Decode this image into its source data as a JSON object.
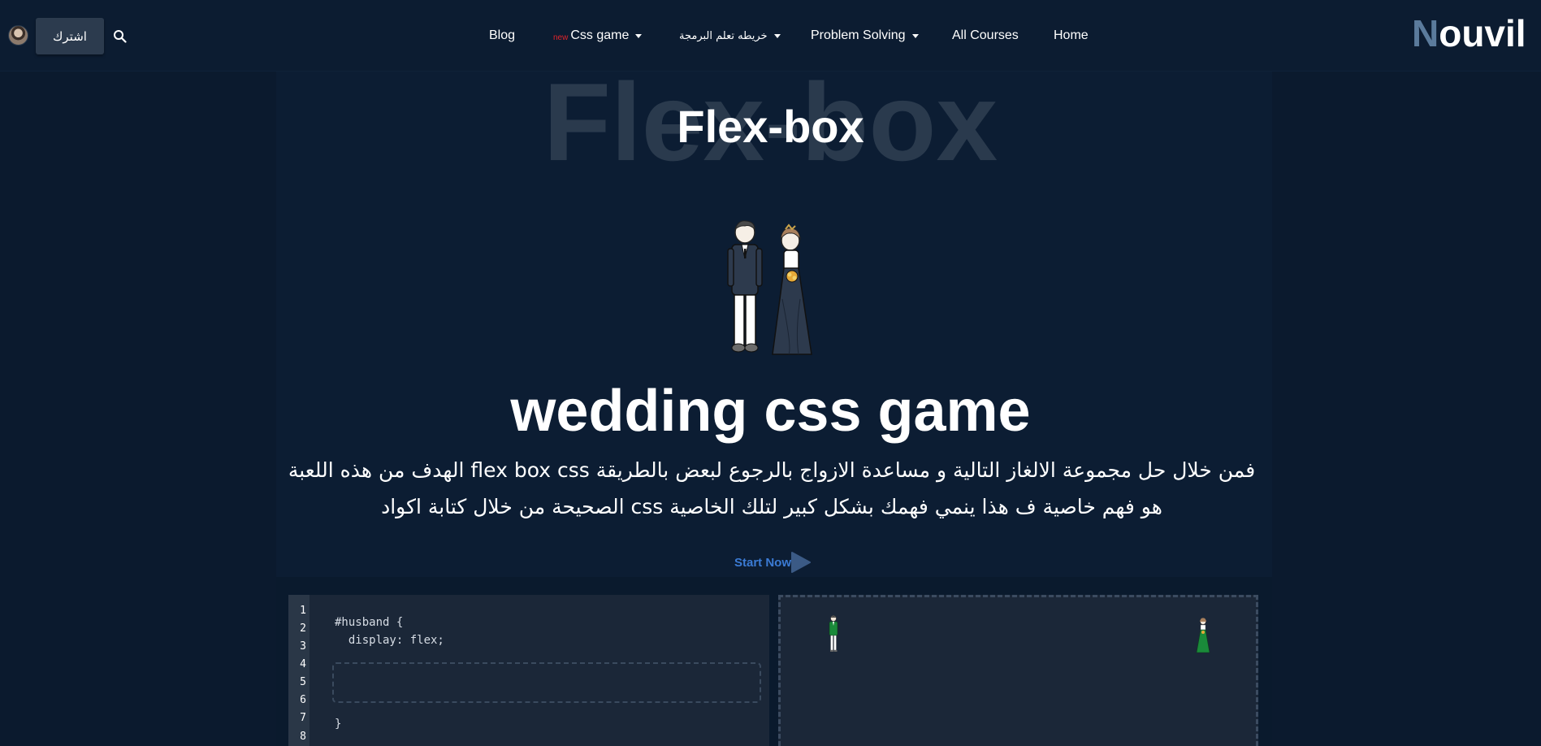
{
  "nav": {
    "subscribe_label": "اشترك",
    "links": [
      {
        "label": "Blog"
      },
      {
        "badge": "new",
        "label": "Css game"
      },
      {
        "label": "خريطه تعلم البرمجة"
      },
      {
        "label": "Problem Solving"
      },
      {
        "label": "All Courses"
      },
      {
        "label": "Home"
      }
    ],
    "logo": {
      "first": "N",
      "rest": "ouvil"
    }
  },
  "hero": {
    "watermark": "Flex-box",
    "title": "Flex-box",
    "game_title": "wedding css game",
    "description": "فمن خلال حل مجموعة الالغاز التالية و مساعدة الازواج بالرجوع لبعض بالطريقة flex box css الهدف من هذه اللعبة هو فهم خاصية ف هذا ينمي فهمك بشكل كبير لتلك الخاصية css الصحيحة من خلال كتابة اكواد",
    "start_label": "Start Now"
  },
  "editor": {
    "line_numbers": [
      "1",
      "2",
      "3",
      "4",
      "5",
      "6",
      "7",
      "8"
    ],
    "code_lines": [
      "#husband {",
      "  display: flex;",
      "}"
    ]
  },
  "colors": {
    "background": "#0b1a2e",
    "navbar": "#0c1c31",
    "accent_blue": "#3b7bd4",
    "new_badge": "#e0242b",
    "logo_n": "#5b7b9c",
    "editor_bg": "#1b2738"
  },
  "icons": {
    "search": "search-icon",
    "start": "play-triangle-icon",
    "caret": "caret-down-icon"
  }
}
